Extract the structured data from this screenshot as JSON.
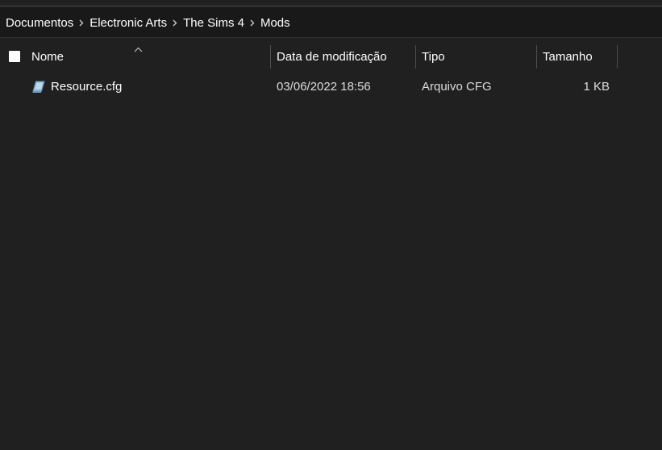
{
  "breadcrumb": {
    "items": [
      "Documentos",
      "Electronic Arts",
      "The Sims 4",
      "Mods"
    ],
    "separator_icon": "chevron-right-icon"
  },
  "columns": {
    "name": "Nome",
    "date": "Data de modificação",
    "type": "Tipo",
    "size": "Tamanho",
    "sort_icon": "sort-ascending-chevron-icon"
  },
  "files": [
    {
      "name": "Resource.cfg",
      "date": "03/06/2022 18:56",
      "type": "Arquivo CFG",
      "size": "1 KB",
      "icon": "config-file-icon"
    }
  ],
  "colors": {
    "background": "#202020",
    "address_bar": "#191919",
    "text": "#ffffff",
    "divider": "#4d4d4d"
  }
}
